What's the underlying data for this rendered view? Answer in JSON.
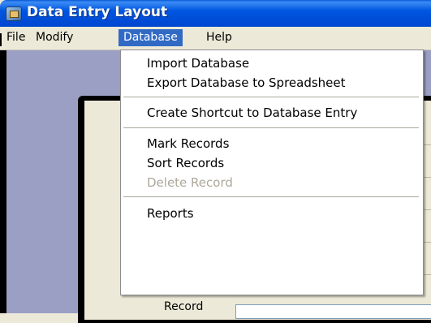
{
  "window": {
    "title": "Data Entry Layout",
    "icon": "app-icon"
  },
  "menubar": {
    "items": [
      {
        "label": "File"
      },
      {
        "label": "Modify"
      },
      {
        "label": "Database",
        "active": true
      },
      {
        "label": "Help"
      }
    ]
  },
  "dropdown": {
    "items": [
      {
        "label": "Import Database",
        "enabled": true
      },
      {
        "label": "Export Database to Spreadsheet",
        "enabled": true
      },
      {
        "label": "Create Shortcut to Database Entry",
        "enabled": true
      },
      {
        "label": "Mark Records",
        "enabled": true
      },
      {
        "label": "Sort Records",
        "enabled": true
      },
      {
        "label": "Delete Record",
        "enabled": false
      },
      {
        "label": "Reports",
        "enabled": true
      }
    ]
  },
  "form": {
    "partial_label": "Record"
  },
  "colors": {
    "title_bar": "#0054e3",
    "menu_highlight": "#316ac5",
    "client_bg": "#9b9fc3",
    "disabled_text": "#aca899"
  }
}
